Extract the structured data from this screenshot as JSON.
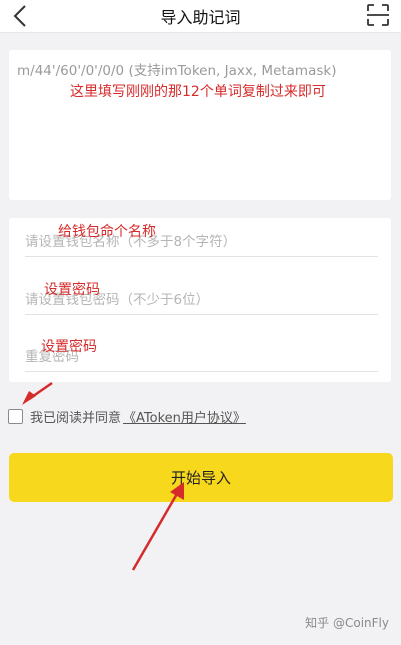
{
  "header": {
    "title": "导入助记词",
    "back_icon": "back-chevron-icon",
    "scan_icon": "scan-icon"
  },
  "mnemonic": {
    "placeholder": "m/44'/60'/0'/0/0 (支持imToken, Jaxx, Metamask)",
    "annotation": "这里填写刚刚的那12个单词复制过来即可"
  },
  "form": {
    "wallet_name": {
      "placeholder": "请设置钱包名称（不多于8个字符）",
      "annotation": "给钱包命个名称"
    },
    "password": {
      "placeholder": "请设置钱包密码（不少于6位）",
      "annotation": "设置密码"
    },
    "repeat_password": {
      "placeholder": "重复密码",
      "annotation": "设置密码"
    }
  },
  "agreement": {
    "text": "我已阅读并同意",
    "link": "《AToken用户协议》",
    "checked": false
  },
  "import_button": {
    "label": "开始导入"
  },
  "watermark": "知乎 @CoinFly",
  "colors": {
    "accent": "#f8d81c",
    "annotation": "#d62b2b",
    "background": "#f2f2f4"
  }
}
